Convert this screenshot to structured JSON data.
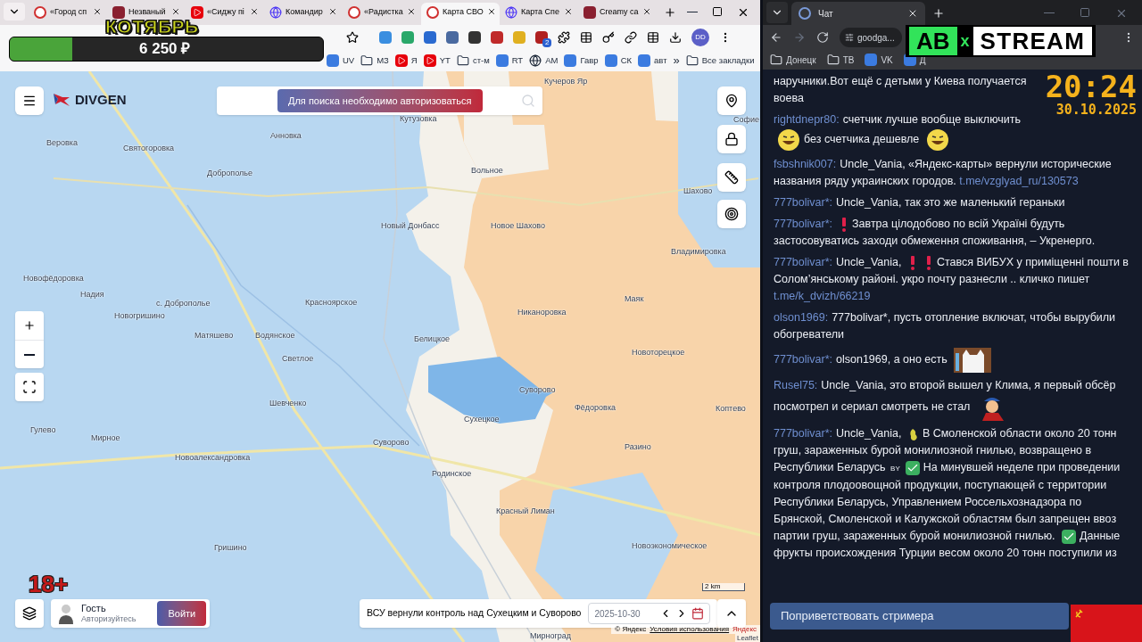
{
  "left_browser": {
    "tabs": [
      {
        "title": "«Город сп",
        "kind": "site",
        "selected": false
      },
      {
        "title": "Незваный",
        "kind": "app",
        "selected": false
      },
      {
        "title": "«Сиджу пі",
        "kind": "video",
        "selected": false
      },
      {
        "title": "Командир",
        "kind": "globe",
        "selected": false
      },
      {
        "title": "«Радистка",
        "kind": "site",
        "selected": false
      },
      {
        "title": "Карта СВО",
        "kind": "site",
        "selected": true
      },
      {
        "title": "Карта Спе",
        "kind": "globe",
        "selected": false
      },
      {
        "title": "Creamy ca",
        "kind": "app",
        "selected": false
      }
    ],
    "extension_badge": "2",
    "profile": "DD",
    "bookmarks": [
      {
        "label": "UV",
        "kind": "site"
      },
      {
        "label": "МЗ",
        "kind": "folder"
      },
      {
        "label": "Я",
        "kind": "video"
      },
      {
        "label": "YT",
        "kind": "video"
      },
      {
        "label": "ст-м",
        "kind": "folder"
      },
      {
        "label": "RT",
        "kind": "site"
      },
      {
        "label": "AM",
        "kind": "globe"
      },
      {
        "label": "Гавр",
        "kind": "site"
      },
      {
        "label": "СК",
        "kind": "site"
      },
      {
        "label": "авт",
        "kind": "site"
      },
      {
        "label": "»",
        "kind": "more"
      },
      {
        "label": "Все закладки",
        "kind": "folder"
      }
    ]
  },
  "donation_goal": {
    "title": "КОТЯБРЬ",
    "amount": "6 250 ₽",
    "level": 0.2
  },
  "map": {
    "logo": "DIVGEN",
    "search_notice": "Для поиска необходимо авторизоваться",
    "labels": [
      "Кучеров Яр",
      "Кутузовка",
      "Софие",
      "Веровка",
      "Святогоровка",
      "Анновка",
      "Доброполье",
      "Вольное",
      "Шахово",
      "Новый Донбасс",
      "Новое Шахово",
      "Владимировка",
      "Новофёдоровка",
      "Надия",
      "с. Доброполье",
      "Красноярское",
      "Никаноровка",
      "Маяк",
      "Новогришино",
      "Матяшево",
      "Водянское",
      "Белицкое",
      "Светлое",
      "Новоторецкое",
      "Суворово",
      "Шевченко",
      "Сухецкое",
      "Фёдоровка",
      "Коптево",
      "Гулево",
      "Мирное",
      "Суворово",
      "Разино",
      "Новоалександровка",
      "Родинское",
      "Красный Лиман",
      "Гришино",
      "Новоэкономическое",
      "Мирноград"
    ],
    "scale": "2 km",
    "user": {
      "name": "Гость",
      "hint": "Авторизуйтесь",
      "login": "Войти"
    },
    "news": {
      "headline": "ВСУ вернули контроль над Сухецким и Суворово",
      "date": "2025-10-30"
    },
    "attribution": {
      "copyright": "© Яндекс",
      "terms": "Условия использования",
      "provider": "Яндекс",
      "library": "Leaflet"
    }
  },
  "age_badge": "18+",
  "right_browser": {
    "tabs": [
      {
        "title": "Чат",
        "selected": true
      }
    ],
    "address": "goodga...",
    "bookmarks": [
      {
        "label": "Донецк",
        "kind": "folder"
      },
      {
        "label": "ТВ",
        "kind": "folder"
      },
      {
        "label": "VK",
        "kind": "site"
      },
      {
        "label": "Д",
        "kind": "site"
      }
    ]
  },
  "stream_logo": {
    "left": "AB",
    "cross": "x",
    "right": "STREAM"
  },
  "clock": {
    "time": "20:24",
    "date": "30.10.2025"
  },
  "chat": {
    "messages": [
      {
        "parts": [
          {
            "kind": "text",
            "text": "наручники.Вот ещё с детьми у Киева получается воева"
          }
        ]
      },
      {
        "user": "rightdnepr80:",
        "parts": [
          {
            "kind": "text",
            "text": "счетчик лучше вообще выключить"
          },
          {
            "kind": "smiley"
          },
          {
            "kind": "text",
            "text": "без счетчика дешевле"
          },
          {
            "kind": "smiley"
          }
        ]
      },
      {
        "user": "fsbshnik007:",
        "parts": [
          {
            "kind": "text",
            "text": "Uncle_Vania, «Яндекс-карты» вернули исторические названия ряду украинских городов."
          },
          {
            "kind": "link",
            "text": "t.me/vzglyad_ru/130573"
          }
        ]
      },
      {
        "user": "777bolivar*:",
        "parts": [
          {
            "kind": "text",
            "text": "Uncle_Vania, так это же маленький гераньки"
          }
        ]
      },
      {
        "user": "777bolivar*:",
        "parts": [
          {
            "kind": "alert"
          },
          {
            "kind": "text",
            "text": "Завтра цілодобово по всій Україні будуть застосовуватись заходи обмеження споживання, – Укренерго."
          }
        ]
      },
      {
        "user": "777bolivar*:",
        "parts": [
          {
            "kind": "text",
            "text": "Uncle_Vania,"
          },
          {
            "kind": "alert"
          },
          {
            "kind": "alert"
          },
          {
            "kind": "text",
            "text": "Стався ВИБУХ у приміщенні пошти в Солом’янському районі. укро почту разнесли .. кличко пишет"
          },
          {
            "kind": "link",
            "text": "t.me/k_dvizh/66219"
          }
        ]
      },
      {
        "user": "olson1969:",
        "parts": [
          {
            "kind": "text",
            "text": "777bolivar*, пусть отопление включат, чтобы вырубили обогреватели"
          }
        ]
      },
      {
        "user": "777bolivar*:",
        "parts": [
          {
            "kind": "text",
            "text": "olson1969, а оно есть"
          },
          {
            "kind": "cat"
          }
        ]
      },
      {
        "user": "Rusel75:",
        "parts": [
          {
            "kind": "text",
            "text": "Uncle_Vania, это второй вышел у Клима, я первый обсёр посмотрел и сериал смотреть не стал"
          },
          {
            "kind": "cartoon"
          }
        ]
      },
      {
        "user": "777bolivar*:",
        "parts": [
          {
            "kind": "text",
            "text": "Uncle_Vania,"
          },
          {
            "kind": "pear"
          },
          {
            "kind": "text",
            "text": "В Смоленской области около 20 тонн груш, зараженных бурой монилиозной гнилью, возвращено в Республики Беларусь"
          },
          {
            "kind": "flag",
            "text": "BY"
          },
          {
            "kind": "check"
          },
          {
            "kind": "text",
            "text": "На минувшей неделе при проведении контроля плодоовощной продукции, поступающей с территории Республики Беларусь, Управлением Россельхознадзора по Брянской, Смоленской и Калужской областям был запрещен ввоз партии груш, зараженных бурой монилиозной гнилью."
          },
          {
            "kind": "check"
          },
          {
            "kind": "text",
            "text": "Данные фрукты происхождения Турции весом около 20 тонн поступили из"
          }
        ]
      }
    ],
    "greet_button": "Поприветствовать стримера"
  }
}
